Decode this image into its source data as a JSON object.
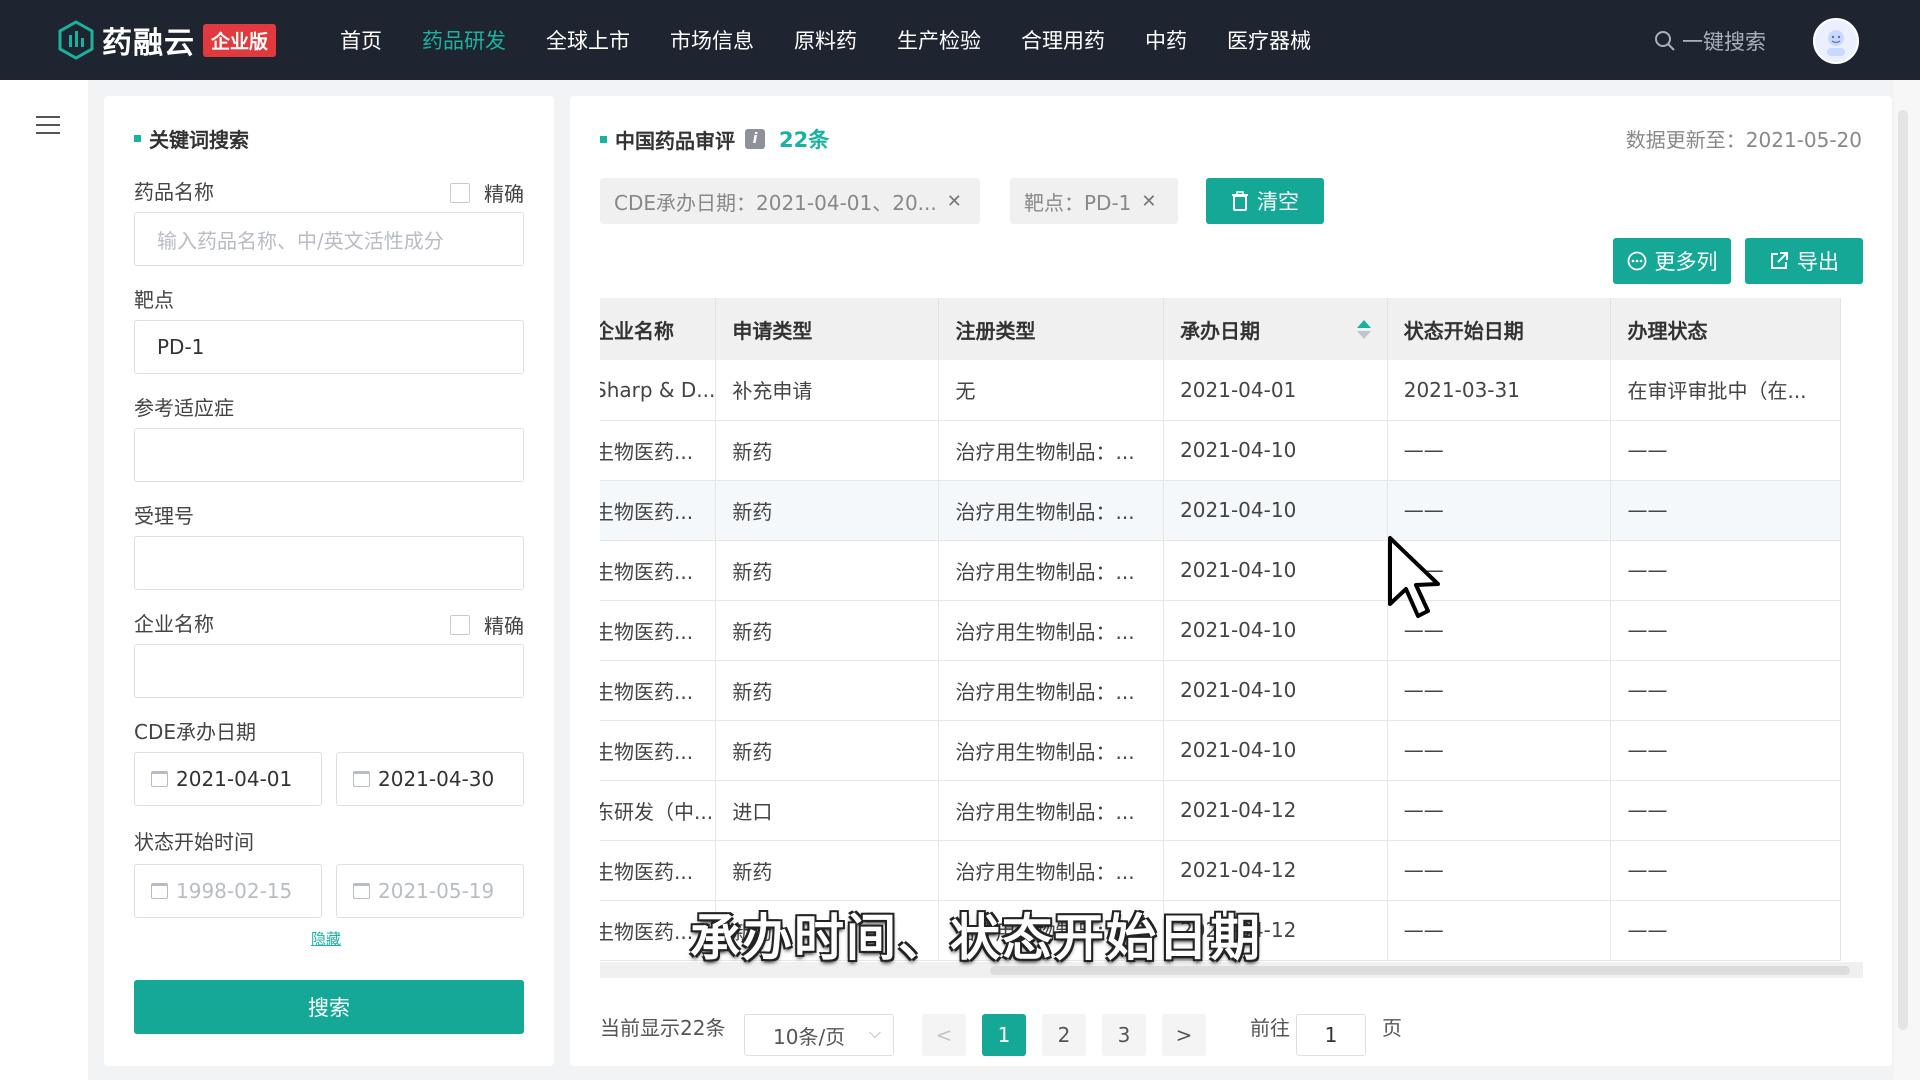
{
  "header": {
    "logo_text": "药融云",
    "logo_badge": "企业版",
    "nav": [
      "首页",
      "药品研发",
      "全球上市",
      "市场信息",
      "原料药",
      "生产检验",
      "合理用药",
      "中药",
      "医疗器械"
    ],
    "active_nav": "药品研发",
    "search_label": "一键搜索"
  },
  "filter": {
    "title": "关键词搜索",
    "drug_name_label": "药品名称",
    "exact_label": "精确",
    "drug_name_placeholder": "输入药品名称、中/英文活性成分",
    "target_label": "靶点",
    "target_value": "PD-1",
    "indication_label": "参考适应症",
    "accept_no_label": "受理号",
    "company_label": "企业名称",
    "company_exact_label": "精确",
    "cde_date_label": "CDE承办日期",
    "cde_date_start": "2021-04-01",
    "cde_date_end": "2021-04-30",
    "status_time_label": "状态开始时间",
    "status_time_start": "1998-02-15",
    "status_time_end": "2021-05-19",
    "hide_link": "隐藏",
    "search_button": "搜索"
  },
  "main": {
    "title": "中国药品审评",
    "count": "22条",
    "updated": "数据更新至：2021-05-20",
    "tags": [
      "CDE承办日期：2021-04-01、20...",
      "靶点：PD-1"
    ],
    "clear_button": "清空",
    "more_columns_button": "更多列",
    "export_button": "导出"
  },
  "table": {
    "columns": [
      "企业名称",
      "申请类型",
      "注册类型",
      "承办日期",
      "状态开始日期",
      "办理状态"
    ],
    "rows": [
      [
        "Sharp & D...",
        "补充申请",
        "无",
        "2021-04-01",
        "2021-03-31",
        "在审评审批中（在..."
      ],
      [
        "生物医药...",
        "新药",
        "治疗用生物制品：...",
        "2021-04-10",
        "——",
        "——"
      ],
      [
        "生物医药...",
        "新药",
        "治疗用生物制品：...",
        "2021-04-10",
        "——",
        "——"
      ],
      [
        "生物医药...",
        "新药",
        "治疗用生物制品：...",
        "2021-04-10",
        "——",
        "——"
      ],
      [
        "生物医药...",
        "新药",
        "治疗用生物制品：...",
        "2021-04-10",
        "——",
        "——"
      ],
      [
        "生物医药...",
        "新药",
        "治疗用生物制品：...",
        "2021-04-10",
        "——",
        "——"
      ],
      [
        "生物医药...",
        "新药",
        "治疗用生物制品：...",
        "2021-04-10",
        "——",
        "——"
      ],
      [
        "东研发（中...",
        "进口",
        "治疗用生物制品：...",
        "2021-04-12",
        "——",
        "——"
      ],
      [
        "生物医药...",
        "新药",
        "治疗用生物制品：...",
        "2021-04-12",
        "——",
        "——"
      ],
      [
        "生物医药...",
        "新药",
        "治疗用生物制品：...",
        "2021-04-12",
        "——",
        "——"
      ]
    ]
  },
  "pagination": {
    "total_text": "当前显示22条",
    "page_size": "10条/页",
    "prev": "<",
    "pages": [
      "1",
      "2",
      "3"
    ],
    "next": ">",
    "goto_label": "前往",
    "goto_value": "1",
    "page_suffix": "页"
  },
  "subtitle": "承办时间、状态开始日期",
  "colors": {
    "accent": "#15a896",
    "nav_bg": "#1f2530"
  }
}
